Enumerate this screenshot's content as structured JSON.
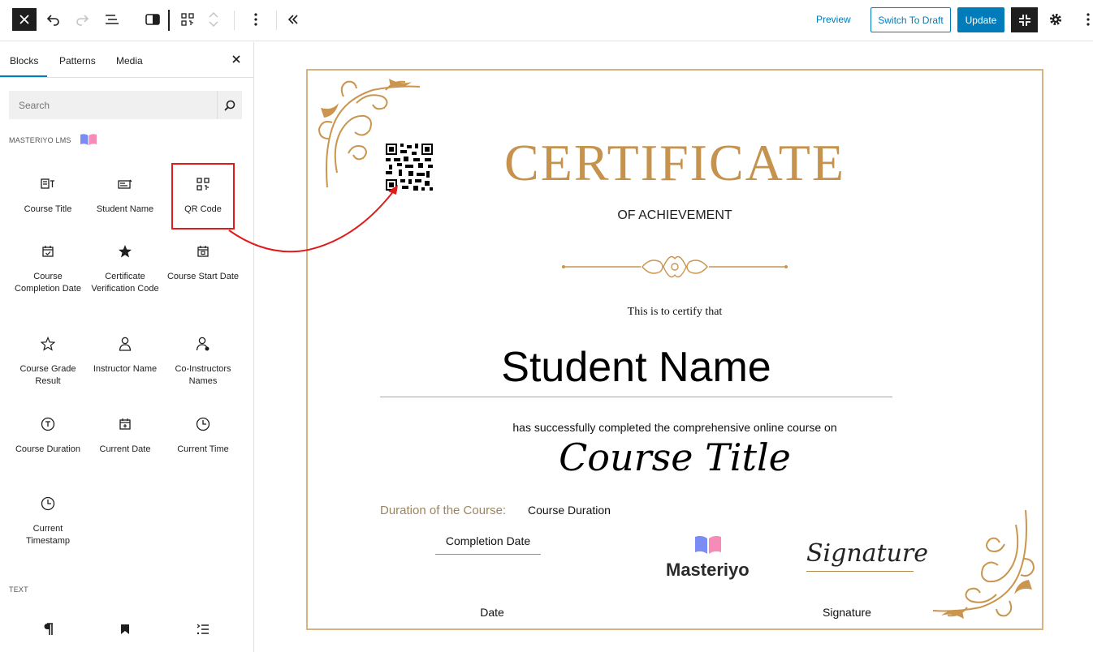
{
  "toolbar": {
    "preview": "Preview",
    "switch_to_draft": "Switch To Draft",
    "update": "Update"
  },
  "sidebar": {
    "tabs": [
      "Blocks",
      "Patterns",
      "Media"
    ],
    "search_placeholder": "Search",
    "category_masteriyo": "MASTERIYO LMS",
    "category_text": "TEXT",
    "blocks": [
      {
        "label": "Course Title",
        "icon": "course-title-icon"
      },
      {
        "label": "Student Name",
        "icon": "student-name-icon"
      },
      {
        "label": "QR Code",
        "icon": "qr-code-icon"
      },
      {
        "label": "Course Completion Date",
        "icon": "calendar-check-icon"
      },
      {
        "label": "Certificate Verification Code",
        "icon": "star-badge-icon"
      },
      {
        "label": "Course Start Date",
        "icon": "calendar-icon"
      },
      {
        "label": "Course Grade Result",
        "icon": "star-icon"
      },
      {
        "label": "Instructor Name",
        "icon": "user-icon"
      },
      {
        "label": "Co-Instructors Names",
        "icon": "users-icon"
      },
      {
        "label": "Course Duration",
        "icon": "timer-icon"
      },
      {
        "label": "Current Date",
        "icon": "calendar-plus-icon"
      },
      {
        "label": "Current Time",
        "icon": "clock-icon"
      },
      {
        "label": "Current Timestamp",
        "icon": "clock-icon"
      }
    ],
    "text_blocks": [
      "paragraph-icon",
      "bookmark-icon",
      "list-icon"
    ]
  },
  "certificate": {
    "title": "CERTIFICATE",
    "subtitle": "OF ACHIEVEMENT",
    "certify_text": "This is to certify that",
    "student_name": "Student Name",
    "completed_text": "has successfully completed the comprehensive online course on",
    "course_title": "Course Title",
    "duration_label": "Duration of the Course:",
    "duration_value": "Course Duration",
    "completion_date": "Completion Date",
    "date_label": "Date",
    "brand": "Masteriyo",
    "signature_script": "Signature",
    "signature_label": "Signature"
  },
  "colors": {
    "accent": "#007cba",
    "gold": "#c5934e",
    "highlight": "#e01b1b"
  }
}
